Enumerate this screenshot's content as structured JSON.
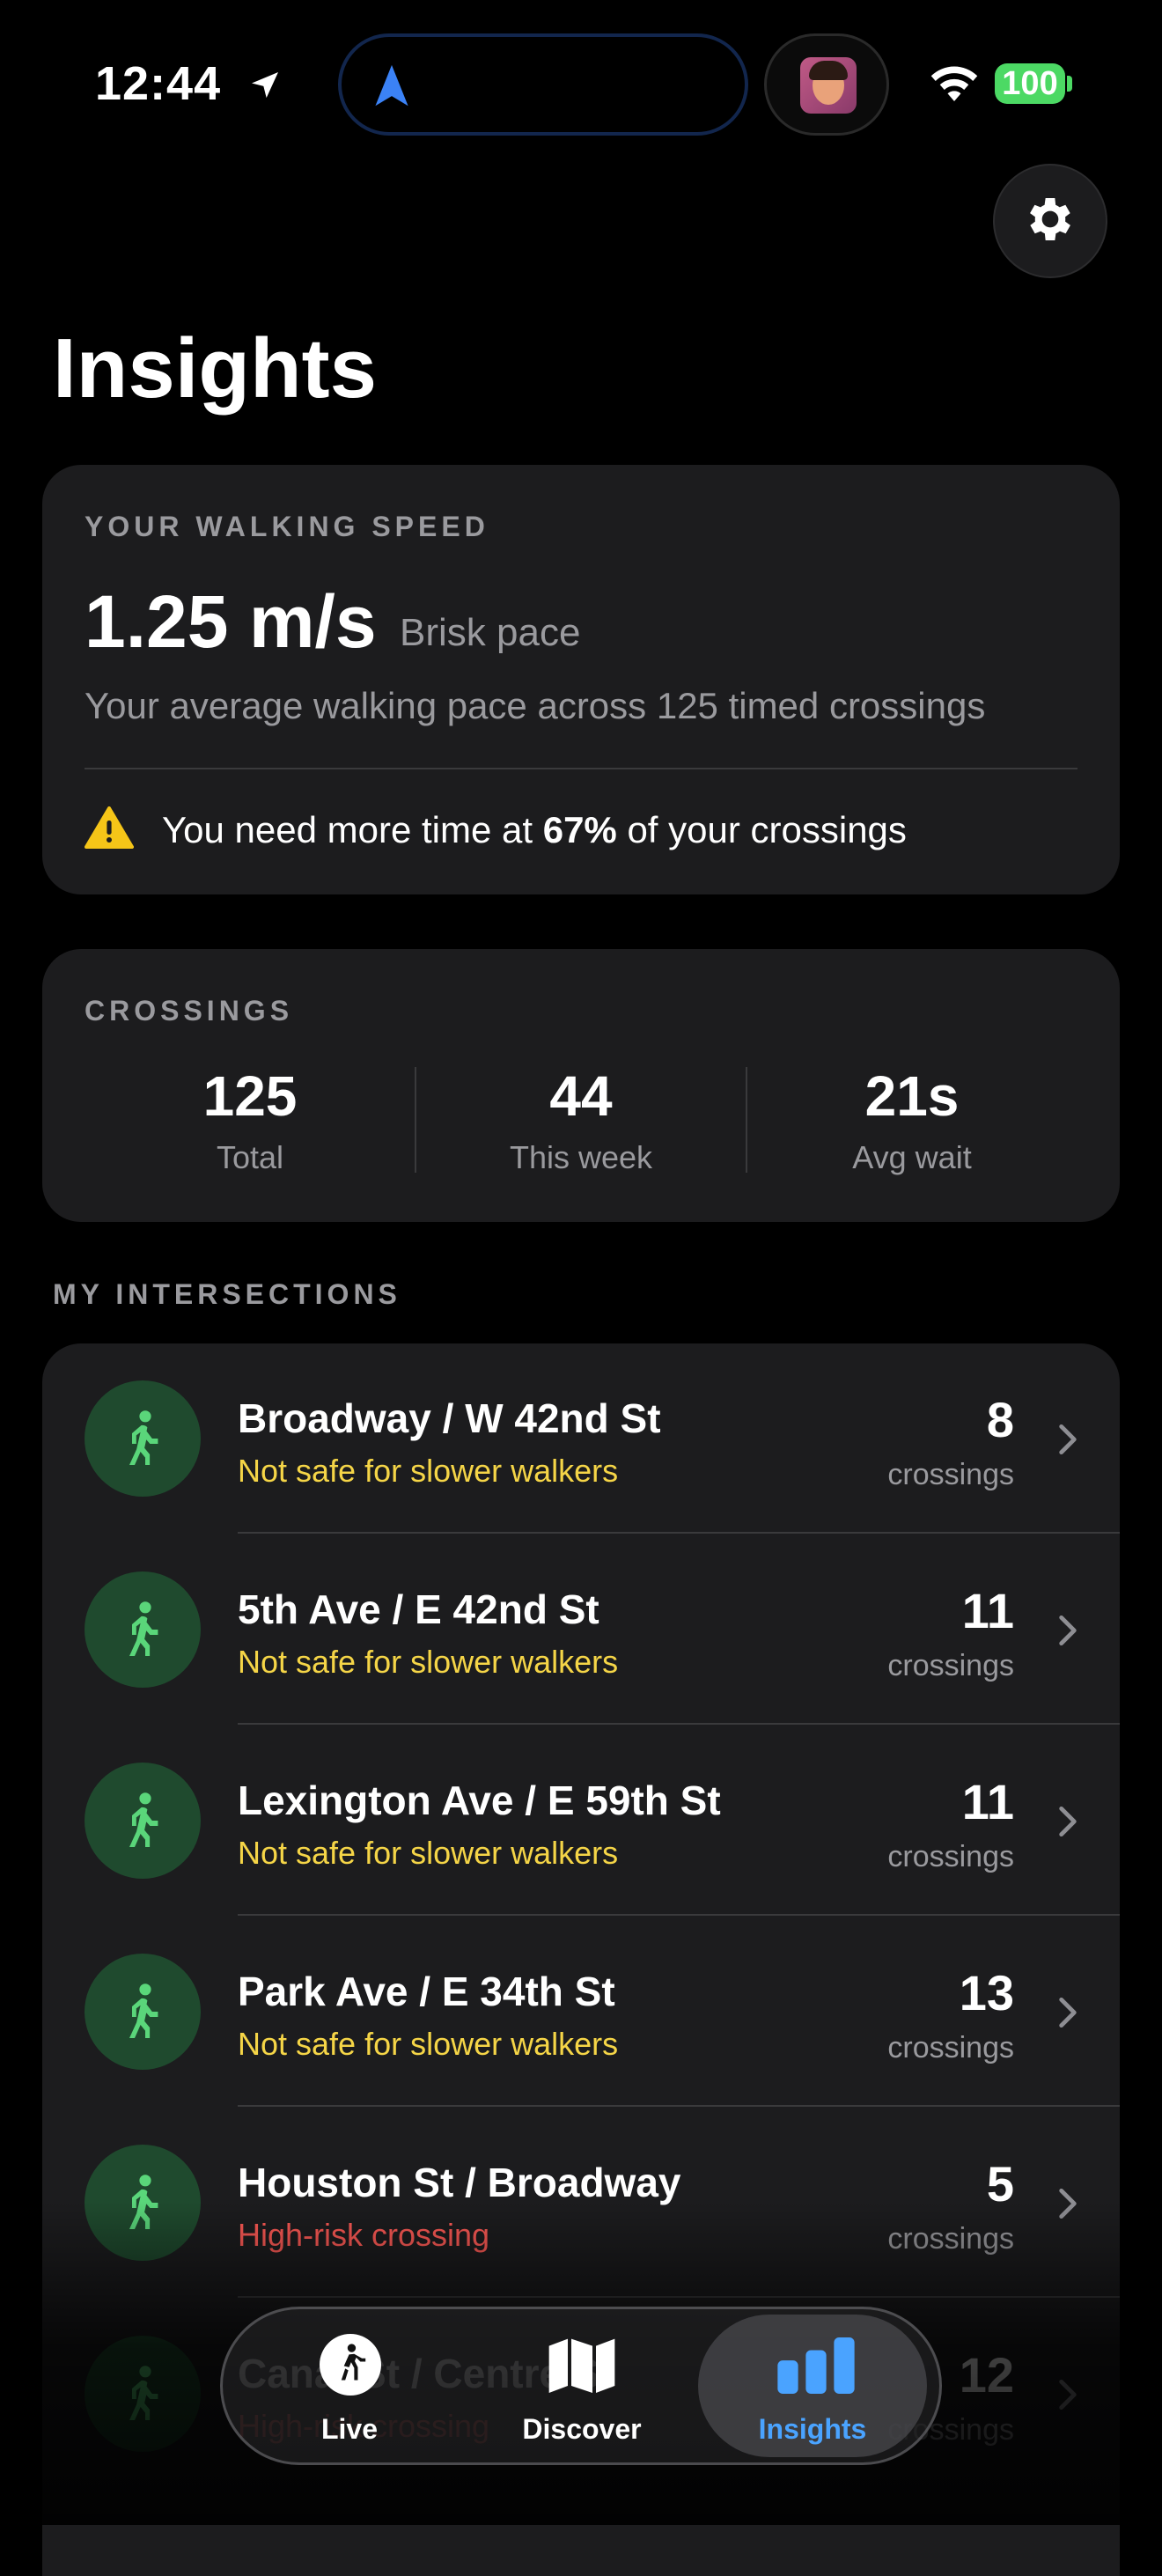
{
  "status_bar": {
    "time": "12:44",
    "battery": "100"
  },
  "header": {
    "title": "Insights"
  },
  "walking_speed": {
    "label": "YOUR WALKING SPEED",
    "value": "1.25 m/s",
    "pace": "Brisk pace",
    "description": "Your average walking pace across 125 timed crossings",
    "warning_prefix": "You need more time at ",
    "warning_percent": "67%",
    "warning_suffix": " of your crossings"
  },
  "crossings": {
    "label": "CROSSINGS",
    "stats": [
      {
        "value": "125",
        "label": "Total"
      },
      {
        "value": "44",
        "label": "This week"
      },
      {
        "value": "21s",
        "label": "Avg wait"
      }
    ]
  },
  "intersections": {
    "label": "MY INTERSECTIONS",
    "unit": "crossings",
    "items": [
      {
        "name": "Broadway / W 42nd St",
        "status": "Not safe for slower walkers",
        "count": "8",
        "status_color": "#f5d547"
      },
      {
        "name": "5th Ave / E 42nd St",
        "status": "Not safe for slower walkers",
        "count": "11",
        "status_color": "#f5d547"
      },
      {
        "name": "Lexington Ave / E 59th St",
        "status": "Not safe for slower walkers",
        "count": "11",
        "status_color": "#f5d547"
      },
      {
        "name": "Park Ave / E 34th St",
        "status": "Not safe for slower walkers",
        "count": "13",
        "status_color": "#f5d547"
      },
      {
        "name": "Houston St / Broadway",
        "status": "High-risk crossing",
        "count": "5",
        "status_color": "#ff5a55"
      },
      {
        "name": "Canal St / Centre St",
        "status": "High-risk crossing",
        "count": "12",
        "status_color": "#ff5a55"
      }
    ]
  },
  "tabs": [
    {
      "label": "Live",
      "icon": "walk-icon"
    },
    {
      "label": "Discover",
      "icon": "map-icon"
    },
    {
      "label": "Insights",
      "icon": "bar-chart-icon",
      "active": true
    }
  ],
  "colors": {
    "accent": "#4aa3ff",
    "safe_green": "#5ad67a",
    "warning_yellow": "#f5d547",
    "danger_red": "#ff5a55"
  }
}
